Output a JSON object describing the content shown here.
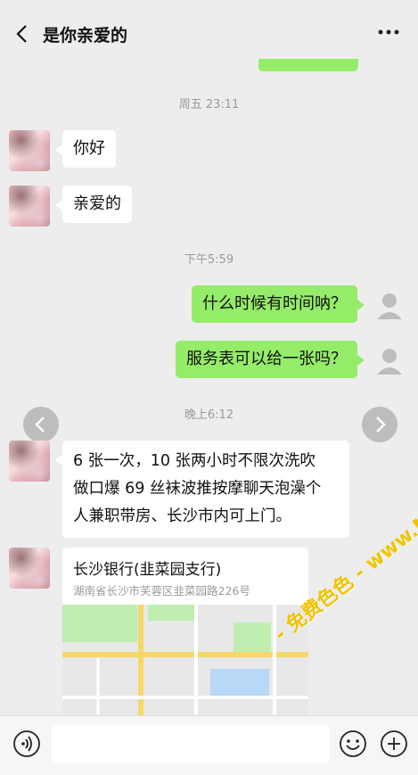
{
  "header": {
    "title": "是你亲爱的"
  },
  "timestamps": {
    "t1": "周五 23:11",
    "t2": "下午5:59",
    "t3": "晚上6:12"
  },
  "messages": [
    {
      "side": "left",
      "text": "你好"
    },
    {
      "side": "left",
      "text": "亲爱的"
    },
    {
      "side": "right",
      "text": "什么时候有时间呐？"
    },
    {
      "side": "right",
      "text": "服务表可以给一张吗？"
    },
    {
      "side": "left",
      "lines": [
        "6 张一次，10 张两小时不限次洗吹",
        "做口爆 69 丝袜波推按摩聊天泡澡个",
        "人兼职带房、长沙市内可上门。"
      ]
    }
  ],
  "location": {
    "name": "长沙银行(韭菜园支行)",
    "address": "湖南省长沙市芙蓉区韭菜园路226号"
  },
  "watermark": "- 免费色色 - www.MFsese.com",
  "icons": [
    "back-arrow-icon",
    "more-dots-icon",
    "voice-icon",
    "emoji-icon",
    "plus-icon",
    "chevron-left-icon",
    "chevron-right-icon",
    "default-avatar-icon"
  ],
  "colors": {
    "my_bubble": "#95ec69",
    "their_bubble": "#ffffff",
    "background": "#ededed"
  }
}
